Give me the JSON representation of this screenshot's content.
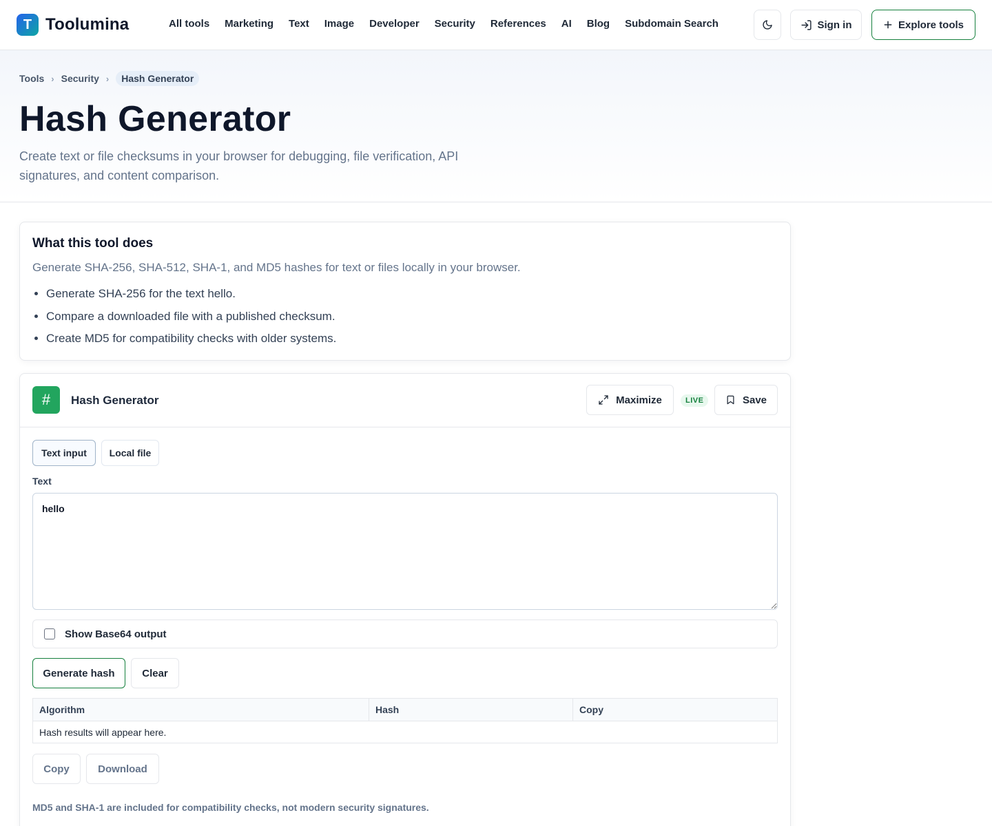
{
  "brand": {
    "logo_letter": "T",
    "name": "Toolumina"
  },
  "nav": {
    "items": [
      "All tools",
      "Marketing",
      "Text",
      "Image",
      "Developer",
      "Security",
      "References",
      "AI",
      "Blog",
      "Subdomain Search"
    ],
    "sign_in": "Sign in",
    "explore": "Explore tools",
    "theme_icon": "moon-icon"
  },
  "breadcrumb": {
    "items": [
      "Tools",
      "Security"
    ],
    "current": "Hash Generator",
    "separator": "›"
  },
  "hero": {
    "title": "Hash Generator",
    "subtitle": "Create text or file checksums in your browser for debugging, file verification, API signatures, and content comparison."
  },
  "about": {
    "heading": "What this tool does",
    "description": "Generate SHA-256, SHA-512, SHA-1, and MD5 hashes for text or files locally in your browser.",
    "examples": [
      "Generate SHA-256 for the text hello.",
      "Compare a downloaded file with a published checksum.",
      "Create MD5 for compatibility checks with older systems."
    ]
  },
  "tool": {
    "icon_glyph": "#",
    "name": "Hash Generator",
    "maximize": "Maximize",
    "live_badge": "LIVE",
    "save": "Save",
    "tabs": {
      "text": "Text input",
      "file": "Local file",
      "active": "text"
    },
    "text_label": "Text",
    "text_value": "hello",
    "base64_label": "Show Base64 output",
    "base64_checked": false,
    "generate": "Generate hash",
    "clear": "Clear",
    "table": {
      "headers": [
        "Algorithm",
        "Hash",
        "Copy"
      ],
      "empty": "Hash results will appear here."
    },
    "copy": "Copy",
    "download": "Download",
    "note": "MD5 and SHA-1 are included for compatibility checks, not modern security signatures."
  },
  "colors": {
    "accent_green": "#15803d",
    "tool_icon_bg": "#22a55e",
    "logo_gradient_start": "#2563eb",
    "logo_gradient_end": "#0ea5a4"
  }
}
